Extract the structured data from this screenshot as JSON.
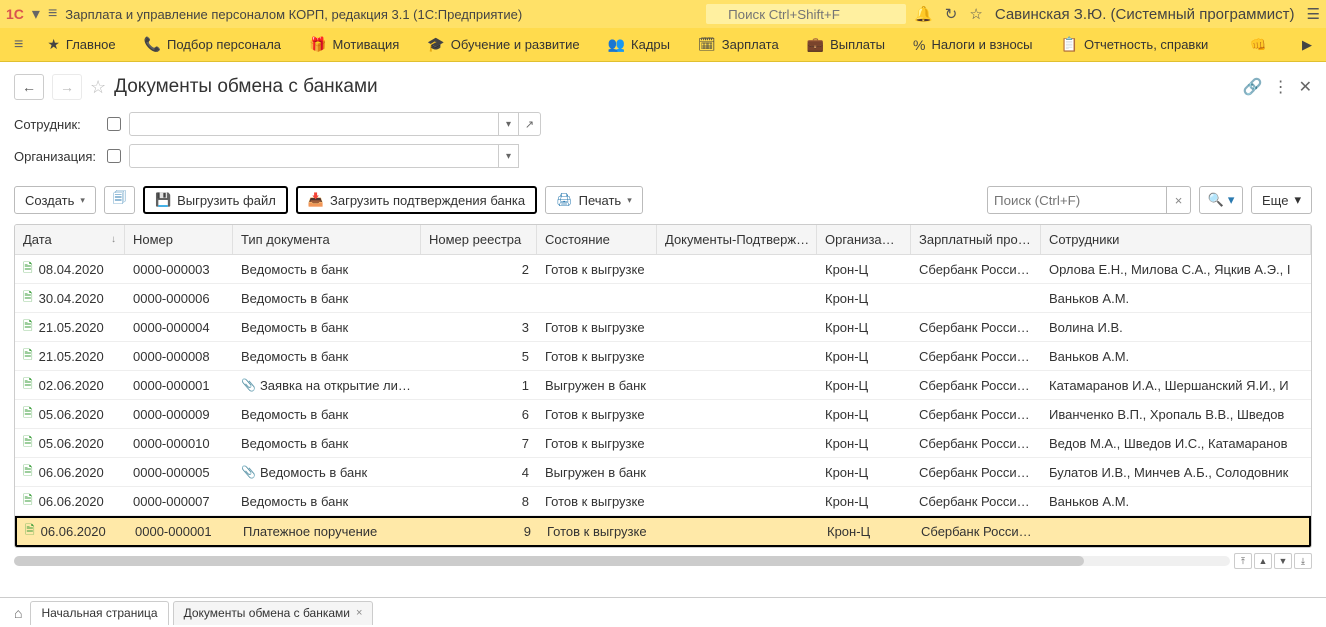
{
  "titlebar": {
    "app_title": "Зарплата и управление персоналом КОРП, редакция 3.1  (1С:Предприятие)",
    "search_placeholder": "Поиск Ctrl+Shift+F",
    "user": "Савинская З.Ю. (Системный программист)"
  },
  "nav": {
    "items": [
      {
        "icon": "★",
        "label": "Главное"
      },
      {
        "icon": "📞",
        "label": "Подбор персонала"
      },
      {
        "icon": "🎁",
        "label": "Мотивация"
      },
      {
        "icon": "🎓",
        "label": "Обучение и развитие"
      },
      {
        "icon": "👥",
        "label": "Кадры"
      },
      {
        "icon": "🗓",
        "label": "Зарплата"
      },
      {
        "icon": "💼",
        "label": "Выплаты"
      },
      {
        "icon": "%",
        "label": "Налоги и взносы"
      },
      {
        "icon": "📋",
        "label": "Отчетность, справки"
      }
    ]
  },
  "page": {
    "title": "Документы обмена с банками"
  },
  "filters": {
    "employee_label": "Сотрудник:",
    "org_label": "Организация:"
  },
  "toolbar": {
    "create": "Создать",
    "export_file": "Выгрузить файл",
    "load_confirm": "Загрузить подтверждения банка",
    "print": "Печать",
    "search_placeholder": "Поиск (Ctrl+F)",
    "more": "Еще"
  },
  "table": {
    "columns": {
      "date": "Дата",
      "number": "Номер",
      "doc_type": "Тип документа",
      "reestr": "Номер реестра",
      "state": "Состояние",
      "confirm": "Документы-Подтверж…",
      "org": "Организа…",
      "project": "Зарплатный про…",
      "employees": "Сотрудники"
    },
    "rows": [
      {
        "date": "08.04.2020",
        "number": "0000-000003",
        "attach": false,
        "type": "Ведомость в банк",
        "reestr": "2",
        "state": "Готов к выгрузке",
        "confirm": "",
        "org": "Крон-Ц",
        "project": "Сбербанк Росси…",
        "emp": "Орлова Е.Н., Милова С.А., Яцкив А.Э., I"
      },
      {
        "date": "30.04.2020",
        "number": "0000-000006",
        "attach": false,
        "type": "Ведомость в банк",
        "reestr": "",
        "state": "",
        "confirm": "",
        "org": "Крон-Ц",
        "project": "",
        "emp": "Ваньков А.М."
      },
      {
        "date": "21.05.2020",
        "number": "0000-000004",
        "attach": false,
        "type": "Ведомость в банк",
        "reestr": "3",
        "state": "Готов к выгрузке",
        "confirm": "",
        "org": "Крон-Ц",
        "project": "Сбербанк Росси…",
        "emp": "Волина И.В."
      },
      {
        "date": "21.05.2020",
        "number": "0000-000008",
        "attach": false,
        "type": "Ведомость в банк",
        "reestr": "5",
        "state": "Готов к выгрузке",
        "confirm": "",
        "org": "Крон-Ц",
        "project": "Сбербанк Росси…",
        "emp": "Ваньков А.М."
      },
      {
        "date": "02.06.2020",
        "number": "0000-000001",
        "attach": true,
        "type": "Заявка на открытие ли…",
        "reestr": "1",
        "state": "Выгружен в банк",
        "confirm": "",
        "org": "Крон-Ц",
        "project": "Сбербанк Росси…",
        "emp": "Катамаранов И.А., Шершанский Я.И., И"
      },
      {
        "date": "05.06.2020",
        "number": "0000-000009",
        "attach": false,
        "type": "Ведомость в банк",
        "reestr": "6",
        "state": "Готов к выгрузке",
        "confirm": "",
        "org": "Крон-Ц",
        "project": "Сбербанк Росси…",
        "emp": "Иванченко В.П., Хропаль В.В., Шведов"
      },
      {
        "date": "05.06.2020",
        "number": "0000-000010",
        "attach": false,
        "type": "Ведомость в банк",
        "reestr": "7",
        "state": "Готов к выгрузке",
        "confirm": "",
        "org": "Крон-Ц",
        "project": "Сбербанк Росси…",
        "emp": "Ведов М.А., Шведов И.С., Катамаранов"
      },
      {
        "date": "06.06.2020",
        "number": "0000-000005",
        "attach": true,
        "type": "Ведомость в банк",
        "reestr": "4",
        "state": "Выгружен в банк",
        "confirm": "",
        "org": "Крон-Ц",
        "project": "Сбербанк Росси…",
        "emp": "Булатов И.В., Минчев А.Б., Солодовник"
      },
      {
        "date": "06.06.2020",
        "number": "0000-000007",
        "attach": false,
        "type": "Ведомость в банк",
        "reestr": "8",
        "state": "Готов к выгрузке",
        "confirm": "",
        "org": "Крон-Ц",
        "project": "Сбербанк Росси…",
        "emp": "Ваньков А.М."
      },
      {
        "date": "06.06.2020",
        "number": "0000-000001",
        "attach": false,
        "type": "Платежное поручение",
        "reestr": "9",
        "state": "Готов к выгрузке",
        "confirm": "",
        "org": "Крон-Ц",
        "project": "Сбербанк Росси…",
        "emp": "",
        "selected": true
      }
    ]
  },
  "tabs": {
    "home": "Начальная страница",
    "active": "Документы обмена с банками"
  }
}
